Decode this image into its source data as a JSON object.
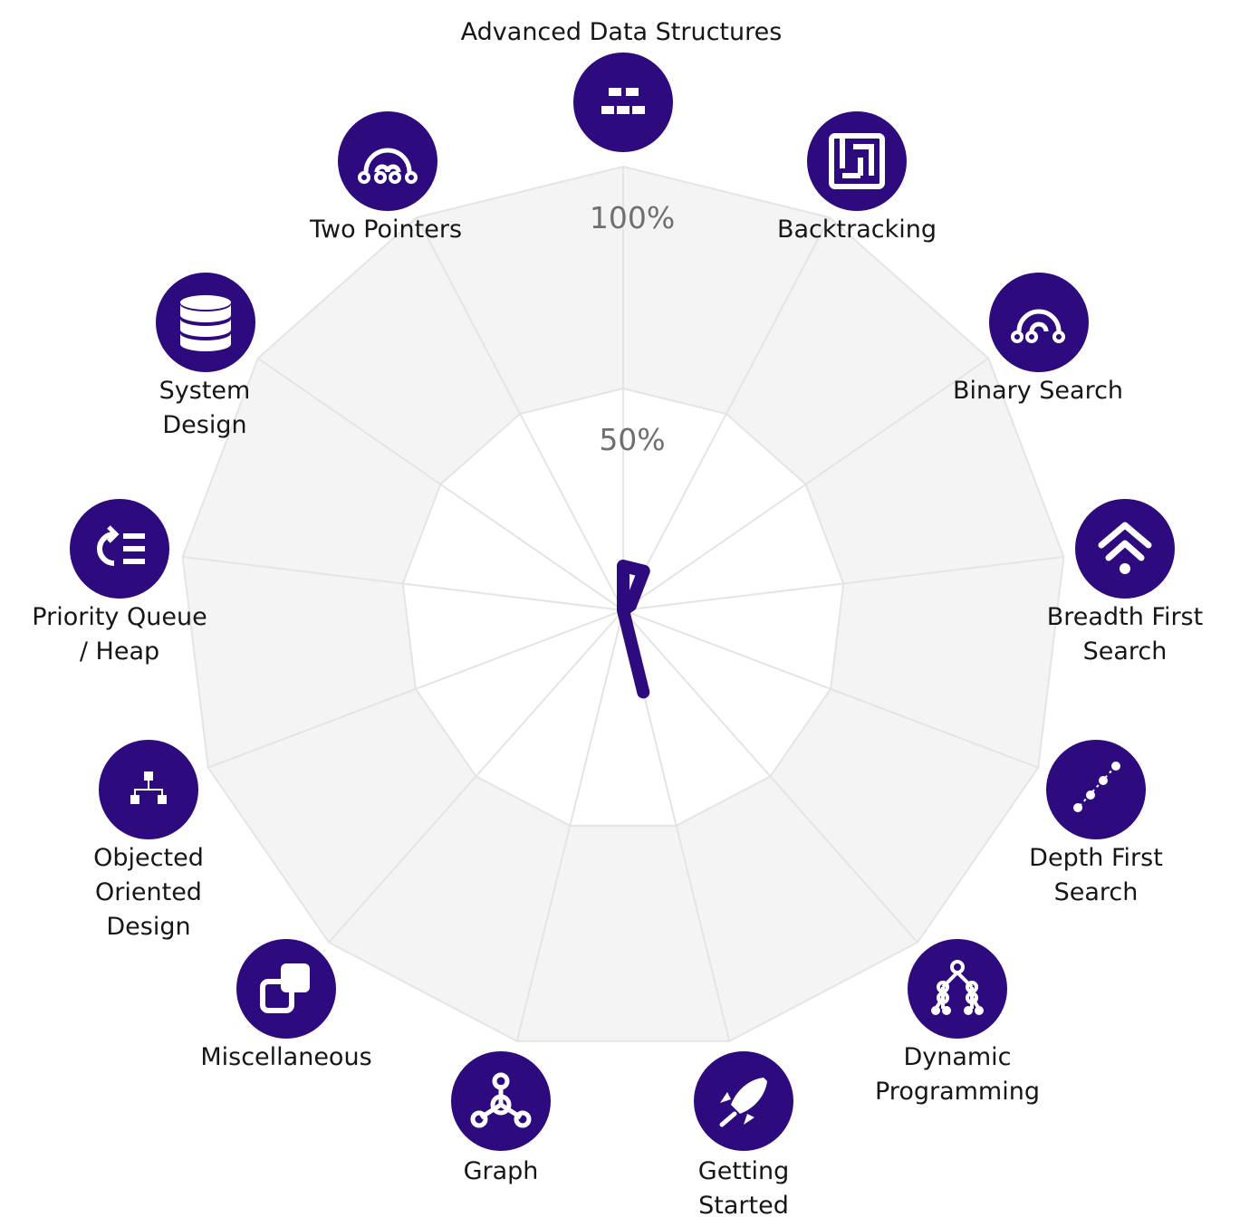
{
  "chart_data": {
    "type": "radar",
    "title": "",
    "categories": [
      "Advanced Data Structures",
      "Backtracking",
      "Binary Search",
      "Breadth First Search",
      "Depth First Search",
      "Dynamic Programming",
      "Getting Started",
      "Graph",
      "Miscellaneous",
      "Objected Oriented Design",
      "Priority Queue / Heap",
      "System Design",
      "Two Pointers"
    ],
    "category_icons": [
      "data-structure-icon",
      "maze-icon",
      "arc-nodes-icon",
      "wave-up-icon",
      "diagonal-path-icon",
      "tree-icon",
      "rocket-icon",
      "graph-nodes-icon",
      "overlapping-squares-icon",
      "hierarchy-icon",
      "queue-list-icon",
      "database-icon",
      "three-node-arc-icon"
    ],
    "series": [
      {
        "values": [
          10,
          10,
          2,
          0,
          0,
          0,
          19,
          0,
          0,
          0,
          0,
          0,
          0
        ]
      }
    ],
    "ring_labels": [
      "100%",
      "50%"
    ],
    "rlim": [
      0,
      100
    ],
    "grid": true,
    "legend": "none",
    "colors": {
      "series": "#2e0a7f",
      "icon_bg": "#2e0a7f",
      "icon_fg": "#ffffff",
      "outer_band": "#f4f4f4",
      "grid": "#e4e4e4"
    }
  }
}
